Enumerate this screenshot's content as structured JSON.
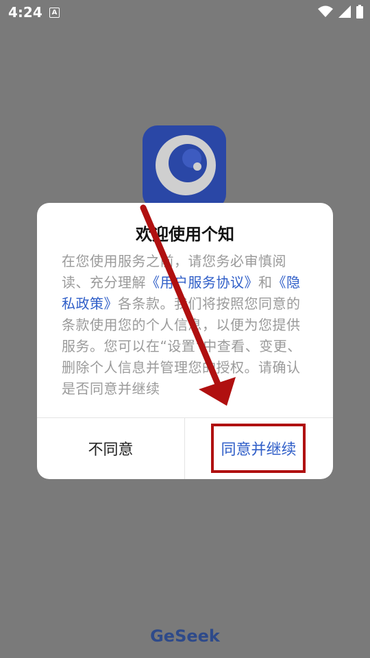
{
  "status_bar": {
    "time": "4:24",
    "notification_icon": "A",
    "icons": [
      "wifi-icon",
      "signal-icon",
      "battery-icon"
    ]
  },
  "app_icon": {
    "name": "app-logo-icon"
  },
  "dialog": {
    "title": "欢迎使用个知",
    "body_parts": [
      "在您使用服务之前，请您务必审慎阅读、充分理解",
      "《用户服务协议》",
      "和",
      "《隐私政策》",
      "各条款。我们将按照您同意的条款使用您的个人信息，以便为您提供服务。您可以在“设置”中查看、变更、删除个人信息并管理您的授权。请确认是否同意并继续"
    ],
    "disagree_label": "不同意",
    "agree_label": "同意并继续"
  },
  "footer": {
    "logo_text": "GeSeek"
  },
  "colors": {
    "accent": "#2f5ec8",
    "highlight": "#b01010",
    "overlay": "#7a7a7a"
  }
}
